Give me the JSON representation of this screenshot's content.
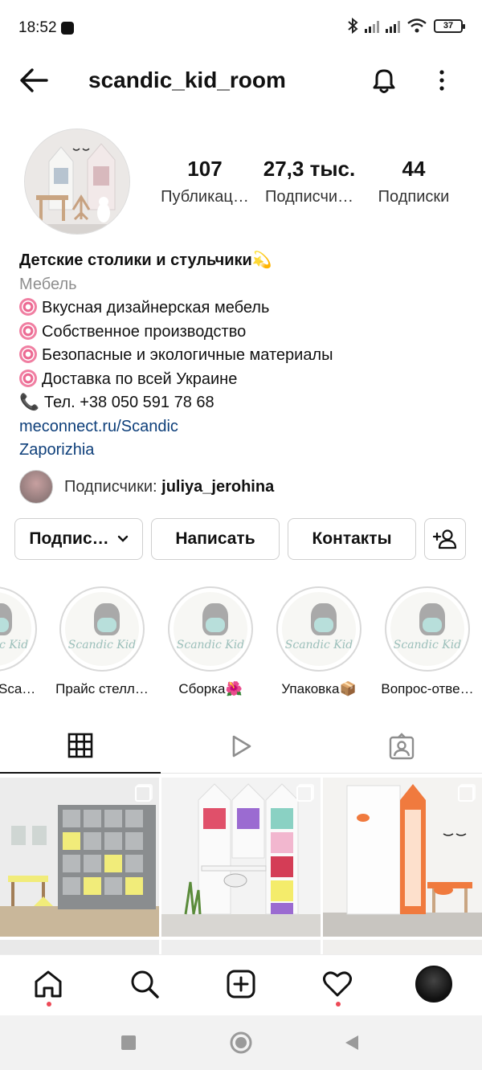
{
  "status": {
    "time": "18:52",
    "battery": "37"
  },
  "header": {
    "username": "scandic_kid_room"
  },
  "stats": [
    {
      "num": "107",
      "label": "Публикац…"
    },
    {
      "num": "27,3 тыс.",
      "label": "Подписчи…"
    },
    {
      "num": "44",
      "label": "Подписки"
    }
  ],
  "bio": {
    "name": "Детские столики и стульчики💫",
    "category": "Мебель",
    "lines": [
      "Вкусная дизайнерская мебель",
      "Собственное производство",
      "Безопасные и экологичные материалы",
      "Доставка по всей Украине"
    ],
    "phone": "Тел. +38 050 591 78 68",
    "link": "meconnect.ru/Scandic",
    "location": "Zaporizhia"
  },
  "followers": {
    "prefix": "Подписчики: ",
    "name": "juliya_jerohina"
  },
  "actions": {
    "follow": "Подпис…",
    "message": "Написать",
    "contacts": "Контакты"
  },
  "highlights": {
    "brand": "Scandic Kid",
    "items": [
      {
        "label": "Sca…"
      },
      {
        "label": "Прайс стелл…"
      },
      {
        "label": "Сборка🌺"
      },
      {
        "label": "Упаковка📦"
      },
      {
        "label": "Вопрос-отве…"
      }
    ]
  },
  "colors": {
    "accent_link": "#0e3f7a",
    "notification_dot": "#ed4956"
  }
}
